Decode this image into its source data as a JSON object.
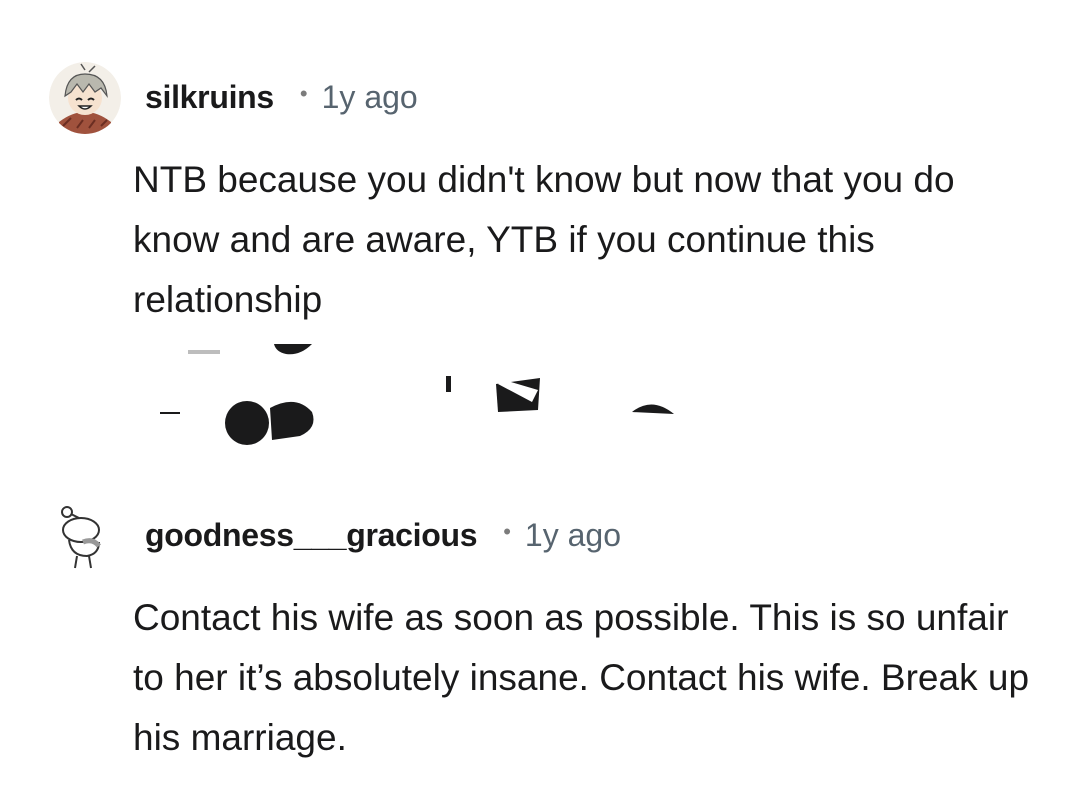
{
  "comments": [
    {
      "username": "silkruins",
      "separator": "•",
      "time": "1y ago",
      "avatar": "anime-character-avatar",
      "body": "NTB because you didn't know but now that you do know and are aware, YTB if you continue this relationship"
    },
    {
      "username": "goodness___gracious",
      "separator": "•",
      "time": "1y ago",
      "avatar": "reddit-snoo-outline-avatar",
      "body": "Contact his wife as soon as possible. This is so unfair to her it’s absolutely insane. Contact his wife. Break up his marriage."
    }
  ],
  "colors": {
    "text": "#1a1a1b",
    "meta": "#57646f",
    "background": "#ffffff"
  }
}
